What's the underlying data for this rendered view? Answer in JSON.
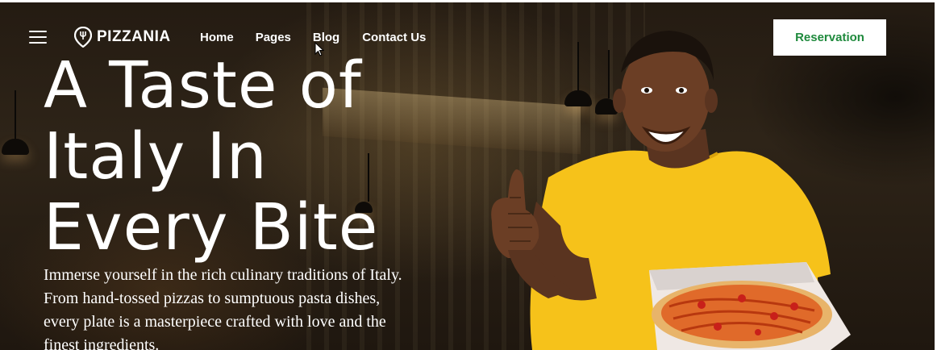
{
  "brand": {
    "name": "PIZZANIA",
    "logo_icon": "location-pin-fork-icon"
  },
  "nav": {
    "menu_icon": "hamburger-menu-icon",
    "items": [
      {
        "label": "Home"
      },
      {
        "label": "Pages"
      },
      {
        "label": "Blog"
      },
      {
        "label": "Contact Us"
      }
    ]
  },
  "cta": {
    "reservation_label": "Reservation"
  },
  "hero": {
    "headline_lines": [
      "A Taste of",
      "Italy In",
      "Every Bite"
    ],
    "intro_lines": [
      "Immerse yourself in the rich culinary traditions of Italy.",
      "From hand-tossed pizzas to sumptuous pasta dishes,",
      "every plate is a masterpiece crafted with love and the",
      "finest ingredients."
    ]
  },
  "colors": {
    "accent": "#1f8a3d",
    "shirt": "#f6c21a",
    "background": "#241b12"
  }
}
